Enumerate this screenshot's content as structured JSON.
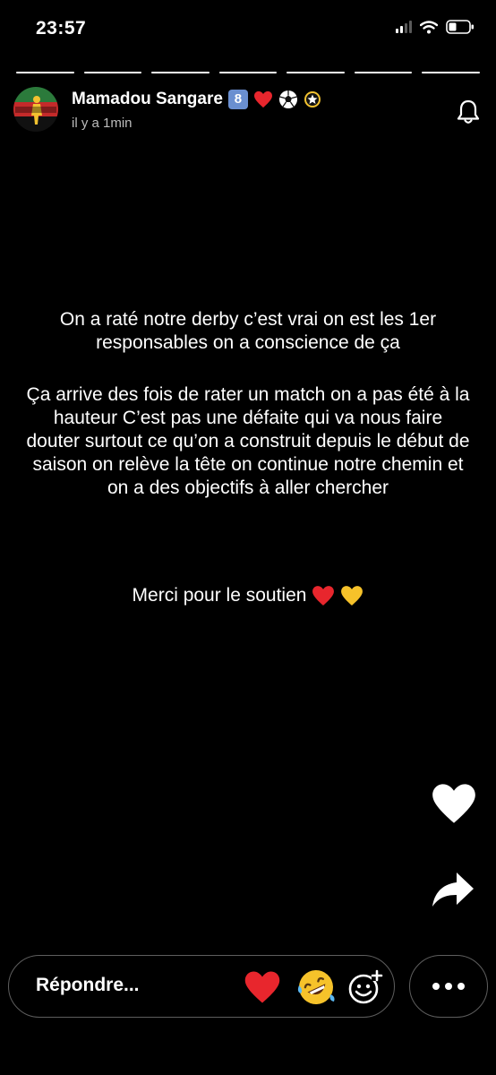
{
  "status_bar": {
    "time": "23:57",
    "signal_icon": "cellular-signal-icon",
    "wifi_icon": "wifi-icon",
    "battery_icon": "battery-icon"
  },
  "story": {
    "segments_total": 7,
    "user": {
      "name": "Mamadou Sangare",
      "badges": [
        "8",
        "red-heart",
        "soccer-ball",
        "star-badge"
      ],
      "avatar_text": "Mon kop fr",
      "timestamp": "il y a 1min"
    },
    "paragraph_1": "On a raté notre derby c’est vrai on est les 1er responsables on a conscience de ça",
    "paragraph_2": "Ça arrive des fois de rater un match on a pas été à la hauteur C’est pas une défaite qui va nous faire douter surtout ce qu’on a construit depuis le début de saison  on relève la tête on continue notre chemin et on a des objectifs à aller chercher",
    "paragraph_3": "Merci pour le soutien",
    "paragraph_3_emojis": [
      "red-heart",
      "yellow-heart"
    ]
  },
  "actions": {
    "like_icon": "heart-icon",
    "share_icon": "share-arrow-icon",
    "reply_placeholder": "Répondre...",
    "quick_reactions": [
      "red-heart",
      "rolling-laughing-face",
      "add-reaction"
    ],
    "more_icon": "more-options-icon"
  },
  "colors": {
    "background": "#000000",
    "text": "#ffffff",
    "heart": "#e8262d",
    "yellow_heart": "#f6c22a",
    "badge_blue": "#6a8fd0"
  }
}
